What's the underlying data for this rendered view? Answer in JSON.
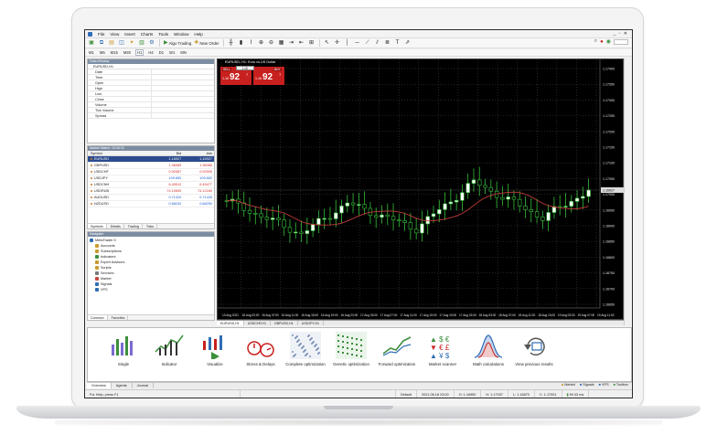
{
  "menubar": {
    "items": [
      "File",
      "View",
      "Insert",
      "Charts",
      "Tools",
      "Window",
      "Help"
    ],
    "window_controls": "_ ▫ ✕"
  },
  "toolbar": {
    "algo_trading_label": "Algo Trading",
    "new_order_label": "New Order"
  },
  "timeframes": [
    "M1",
    "M5",
    "M15",
    "M30",
    "H1",
    "H4",
    "D1",
    "W1",
    "MN"
  ],
  "active_timeframe": "H1",
  "data_window": {
    "title": "Data Window",
    "symbol": "EURUSD,H1",
    "rows": [
      "Date",
      "Time",
      "Open",
      "High",
      "Low",
      "Close",
      "Volume",
      "Tick Volume",
      "Spread"
    ]
  },
  "market_watch": {
    "title": "Market Watch: 13:26:31",
    "headers": {
      "symbol": "Symbol",
      "bid": "Bid",
      "ask": "Ask"
    },
    "rows": [
      {
        "symbol": "EURUSD",
        "bid": "1.16927",
        "ask": "1.16927",
        "trend": "up"
      },
      {
        "symbol": "GBPUSD",
        "bid": "1.36085",
        "ask": "1.36085",
        "trend": "down"
      },
      {
        "symbol": "USDCHF",
        "bid": "0.92587",
        "ask": "0.92595",
        "trend": "down"
      },
      {
        "symbol": "USDJPY",
        "bid": "109.650",
        "ask": "109.662",
        "trend": "up"
      },
      {
        "symbol": "USDCNH",
        "bid": "6.49512",
        "ask": "6.49477",
        "trend": "down"
      },
      {
        "symbol": "USDRUB",
        "bid": "74.10690",
        "ask": "74.12180",
        "trend": "down"
      },
      {
        "symbol": "AUDUSD",
        "bid": "0.71420",
        "ask": "0.71426",
        "trend": "up"
      },
      {
        "symbol": "NZDUSD",
        "bid": "0.68242",
        "ask": "0.68250",
        "trend": "up"
      }
    ],
    "tabs": [
      "Symbols",
      "Details",
      "Trading",
      "Ticks"
    ]
  },
  "navigator": {
    "title": "Navigator",
    "items": [
      {
        "label": "MetaTrader 5",
        "color": "#2f6db5"
      },
      {
        "label": "Accounts",
        "color": "#c99a2e"
      },
      {
        "label": "Subscriptions",
        "color": "#c99a2e"
      },
      {
        "label": "Indicators",
        "color": "#3c8f3c"
      },
      {
        "label": "Expert Advisors",
        "color": "#c99a2e"
      },
      {
        "label": "Scripts",
        "color": "#c99a2e"
      },
      {
        "label": "Services",
        "color": "#7a7a7a"
      },
      {
        "label": "Market",
        "color": "#c9463b"
      },
      {
        "label": "Signals",
        "color": "#2f6db5"
      },
      {
        "label": "VPS",
        "color": "#2f6db5"
      }
    ],
    "tabs": [
      "Common",
      "Favorites"
    ]
  },
  "chart": {
    "title": "EURUSD, H1: Euro vs US Dollar",
    "sell": {
      "label": "SELL",
      "small": "1.16",
      "big": "92",
      "sup": "7"
    },
    "buy": {
      "label": "BUY",
      "small": "1.16",
      "big": "92",
      "sup": "7"
    },
    "lot": "1.00",
    "current_price": "1.16927",
    "price_labels": [
      "1.17400",
      "1.17350",
      "1.17300",
      "1.17250",
      "1.17200",
      "1.17150",
      "1.17100",
      "1.17050",
      "1.17000",
      "1.16950",
      "1.16900",
      "1.16850",
      "1.16800",
      "1.16750",
      "1.16700",
      "1.16650"
    ],
    "time_labels": [
      "13 Aug 2021",
      "16 Aug 03:00",
      "16 Aug 07:00",
      "16 Aug 11:00",
      "16 Aug 15:00",
      "16 Aug 19:00",
      "16 Aug 23:00",
      "17 Aug 03:00",
      "17 Aug 07:00",
      "17 Aug 11:00",
      "17 Aug 15:00",
      "17 Aug 19:00",
      "17 Aug 23:00",
      "18 Aug 03:00",
      "18 Aug 07:00",
      "18 Aug 11:00",
      "18 Aug 15:00",
      "19 Aug 03:00",
      "19 Aug 07:00",
      "19 Aug 11:00"
    ],
    "colors": {
      "bull": "#ffffff",
      "bear": "#000000",
      "wick": "#35c13a",
      "ma": "#c23b3b",
      "grid": "#5a5a5a",
      "price_tag": "#dcdcdc"
    },
    "tabs": [
      "EURUSD,H1",
      "USDCHF,H1",
      "GBPUSD,H1",
      "USDJPY,H1"
    ]
  },
  "tester": {
    "items": [
      "Single",
      "Indicator",
      "Visualize",
      "Stress & Delays",
      "Complete optimization",
      "Genetic optimization",
      "Forward optimization",
      "Market scanner",
      "Math calculations",
      "View previous results"
    ],
    "tabs": [
      "Overview",
      "Agents",
      "Journal"
    ],
    "links": [
      "Market",
      "Signals",
      "VPS",
      "Toolbox"
    ]
  },
  "statusbar": {
    "help": "For Help, press F1",
    "profile": "Default",
    "datetime": "2021.08.18 23:00",
    "open": "O: 1.16950",
    "high": "H: 1.17037",
    "low": "L: 1.16870",
    "close": "C: 1.17001",
    "ping": "59.33 ms"
  }
}
